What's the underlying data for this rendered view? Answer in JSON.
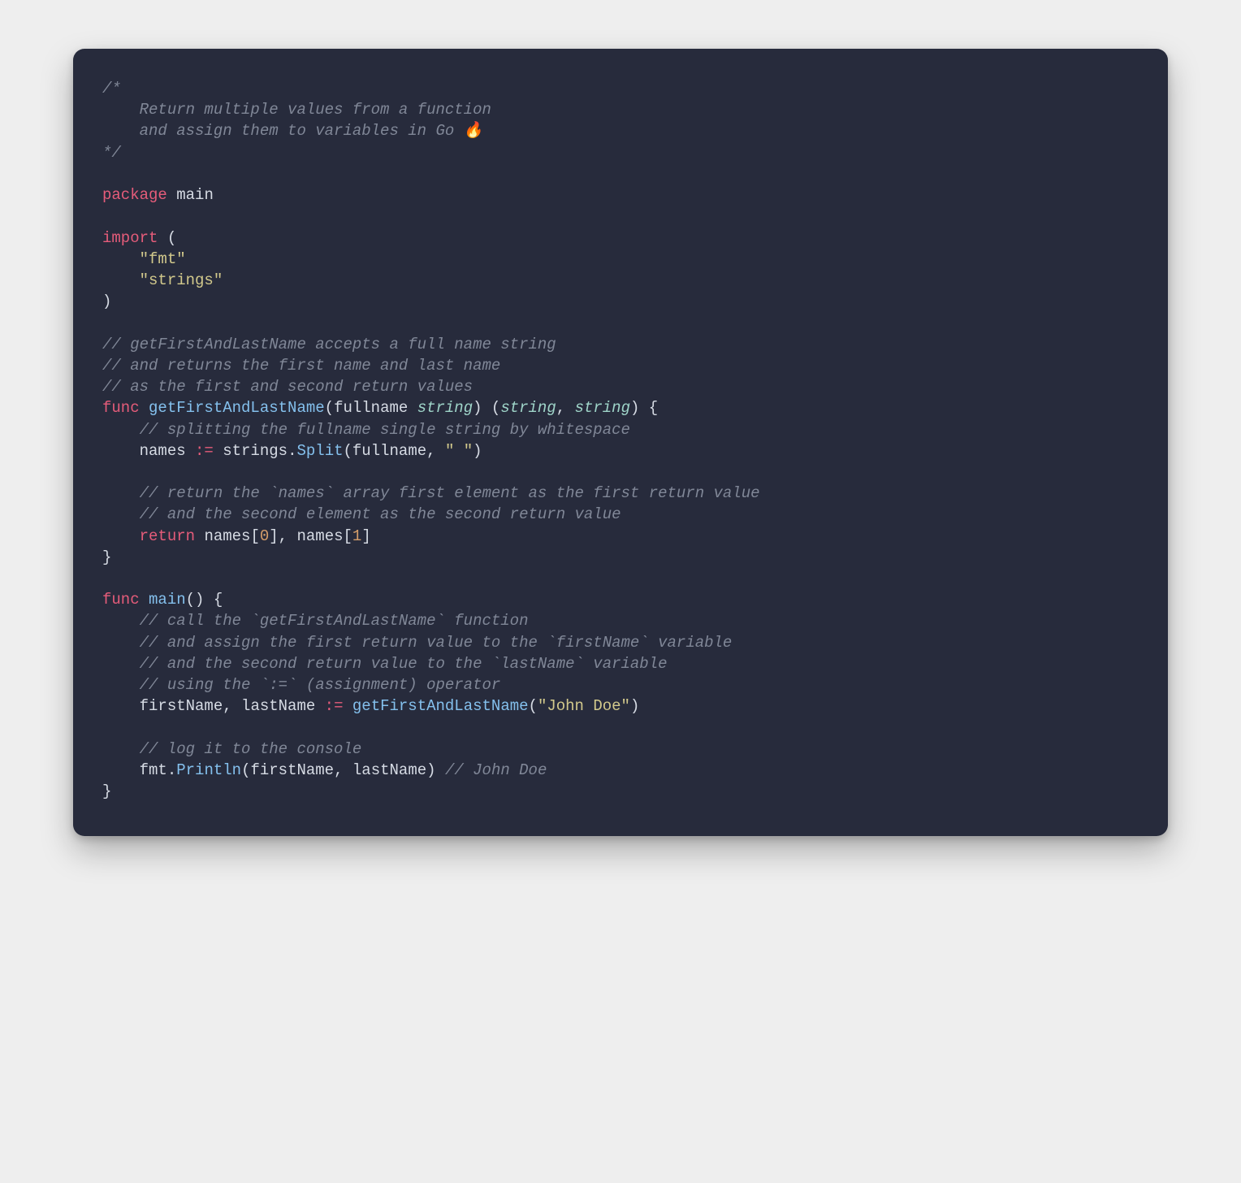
{
  "code": {
    "c1_l1": "/*",
    "c1_l2": "    Return multiple values from a function",
    "c1_l3": "    and assign them to variables in Go 🔥",
    "c1_l4": "*/",
    "kw_package": "package",
    "pkg_main": "main",
    "kw_import": "import",
    "paren_open": "(",
    "paren_close": ")",
    "str_fmt": "\"fmt\"",
    "str_strings": "\"strings\"",
    "c2_l1": "// getFirstAndLastName accepts a full name string",
    "c2_l2": "// and returns the first name and last name",
    "c2_l3": "// as the first and second return values",
    "kw_func": "func",
    "fn_getFirstAndLastName": "getFirstAndLastName",
    "param_fullname": "fullname",
    "type_string": "string",
    "comma": ",",
    "brace_open": "{",
    "brace_close": "}",
    "c3": "// splitting the fullname single string by whitespace",
    "id_names": "names",
    "op_decl": ":=",
    "id_strings": "strings",
    "dot": ".",
    "fn_Split": "Split",
    "id_fullname": "fullname",
    "str_space": "\" \"",
    "c4_l1": "// return the `names` array first element as the first return value",
    "c4_l2": "// and the second element as the second return value",
    "kw_return": "return",
    "lbracket": "[",
    "rbracket": "]",
    "num_0": "0",
    "num_1": "1",
    "fn_main": "main",
    "c5_l1": "// call the `getFirstAndLastName` function",
    "c5_l2": "// and assign the first return value to the `firstName` variable",
    "c5_l3": "// and the second return value to the `lastName` variable",
    "c5_l4": "// using the `:=` (assignment) operator",
    "id_firstName": "firstName",
    "id_lastName": "lastName",
    "str_johndoe": "\"John Doe\"",
    "c6": "// log it to the console",
    "id_fmt": "fmt",
    "fn_Println": "Println",
    "c7": "// John Doe"
  }
}
